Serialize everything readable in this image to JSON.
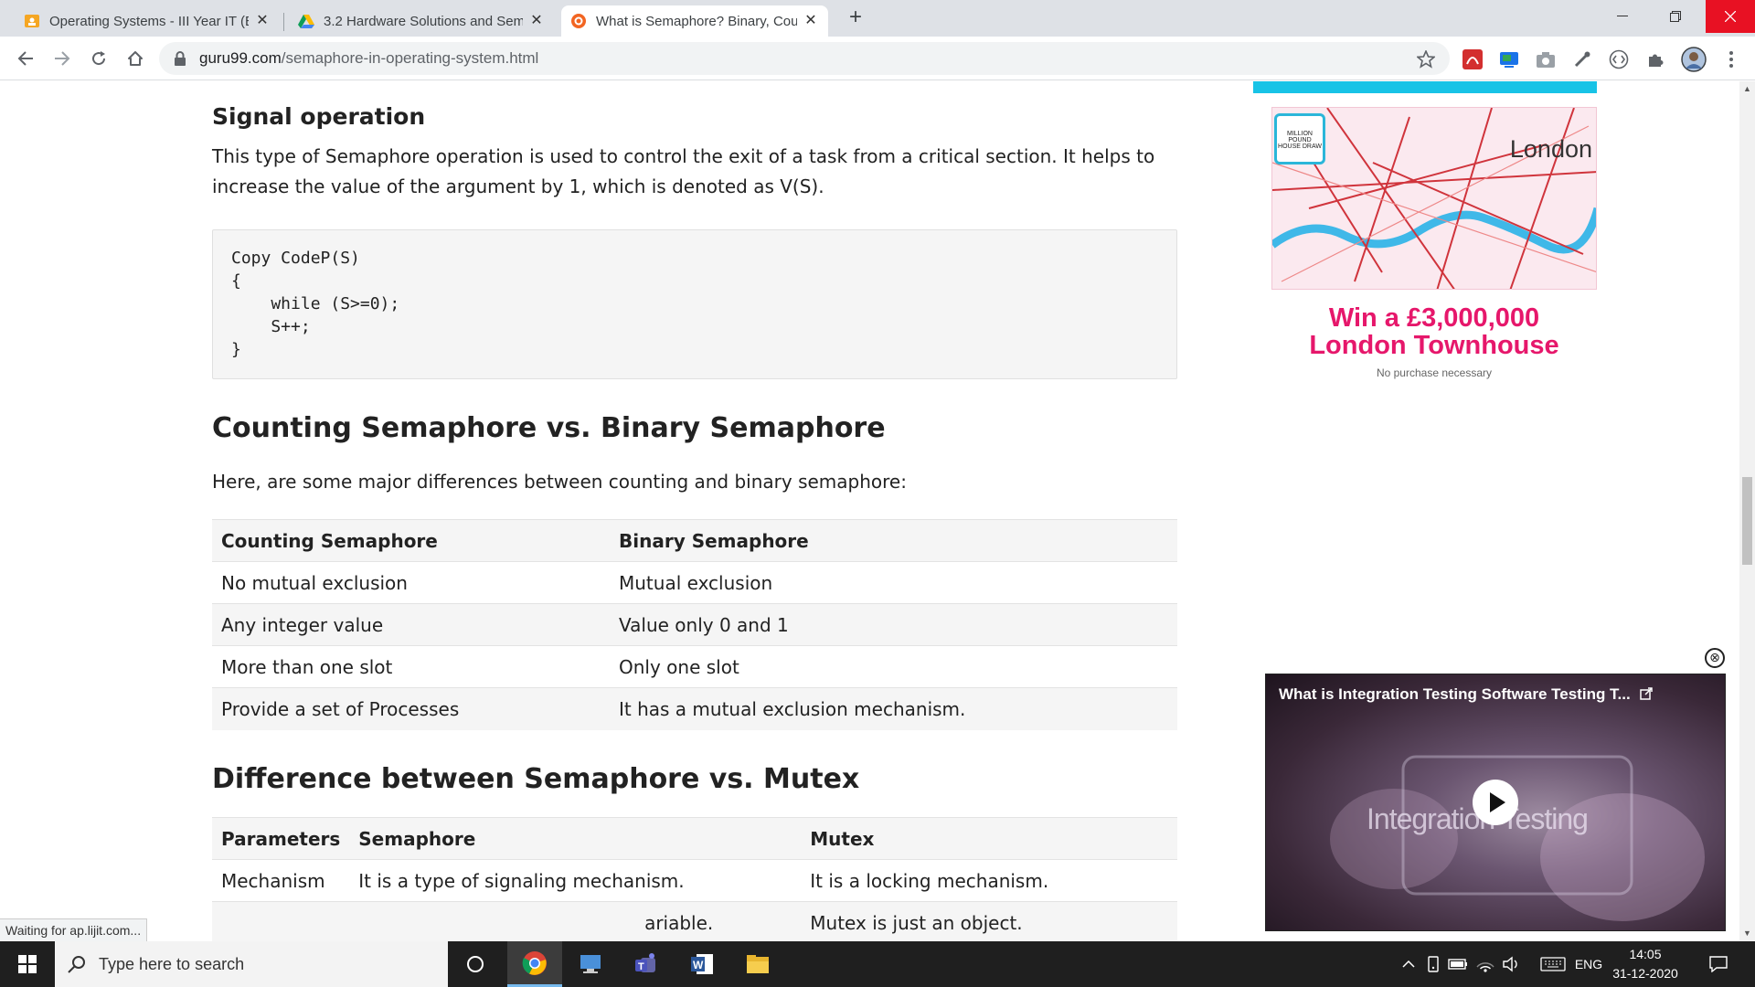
{
  "browser": {
    "tabs": [
      {
        "title": "Operating Systems - III Year IT (B",
        "icon": "google-classroom-icon"
      },
      {
        "title": "3.2 Hardware Solutions and Sem",
        "icon": "google-drive-icon"
      },
      {
        "title": "What is Semaphore? Binary, Coun",
        "icon": "guru99-icon"
      }
    ],
    "url_host": "guru99.com",
    "url_path": "/semaphore-in-operating-system.html"
  },
  "article": {
    "signal_heading": "Signal operation",
    "signal_text": "This type of Semaphore operation is used to control the exit of a task from a critical section. It helps to increase the value of the argument by 1, which is denoted as V(S).",
    "code_lines": [
      "Copy CodeP(S)",
      "{",
      "    while (S>=0);",
      "    S++;",
      "}"
    ],
    "counting_heading": "Counting Semaphore vs. Binary Semaphore",
    "counting_intro": "Here, are some major differences between counting and binary semaphore:",
    "counting_table": {
      "headers": [
        "Counting Semaphore",
        "Binary Semaphore"
      ],
      "rows": [
        [
          "No mutual exclusion",
          "Mutual exclusion"
        ],
        [
          "Any integer value",
          "Value only 0 and 1"
        ],
        [
          "More than one slot",
          "Only one slot"
        ],
        [
          "Provide a set of Processes",
          "It has a mutual exclusion mechanism."
        ]
      ]
    },
    "mutex_heading": "Difference between Semaphore vs. Mutex",
    "mutex_table": {
      "headers": [
        "Parameters",
        "Semaphore",
        "Mutex"
      ],
      "rows": [
        [
          "Mechanism",
          "It is a type of signaling mechanism.",
          "It is a locking mechanism."
        ],
        [
          "",
          "ariable.",
          "Mutex is just an object."
        ]
      ]
    }
  },
  "ad": {
    "map_label": "London",
    "badge_text": "MILLION POUND HOUSE DRAW",
    "headline1": "Win a £3,000,000",
    "headline2": "London Townhouse",
    "fineprint": "No purchase necessary"
  },
  "video": {
    "title": "What is Integration Testing Software Testing T...",
    "overlay_text": "Integration Testing",
    "close_glyph": "⊗"
  },
  "status_text": "Waiting for ap.lijit.com...",
  "taskbar": {
    "search_placeholder": "Type here to search",
    "language": "ENG",
    "time": "14:05",
    "date": "31-12-2020"
  },
  "colors": {
    "accent_pink": "#e6176b",
    "ad_bar_cyan": "#18c3e6",
    "taskbar_bg": "#1f1f1f"
  }
}
